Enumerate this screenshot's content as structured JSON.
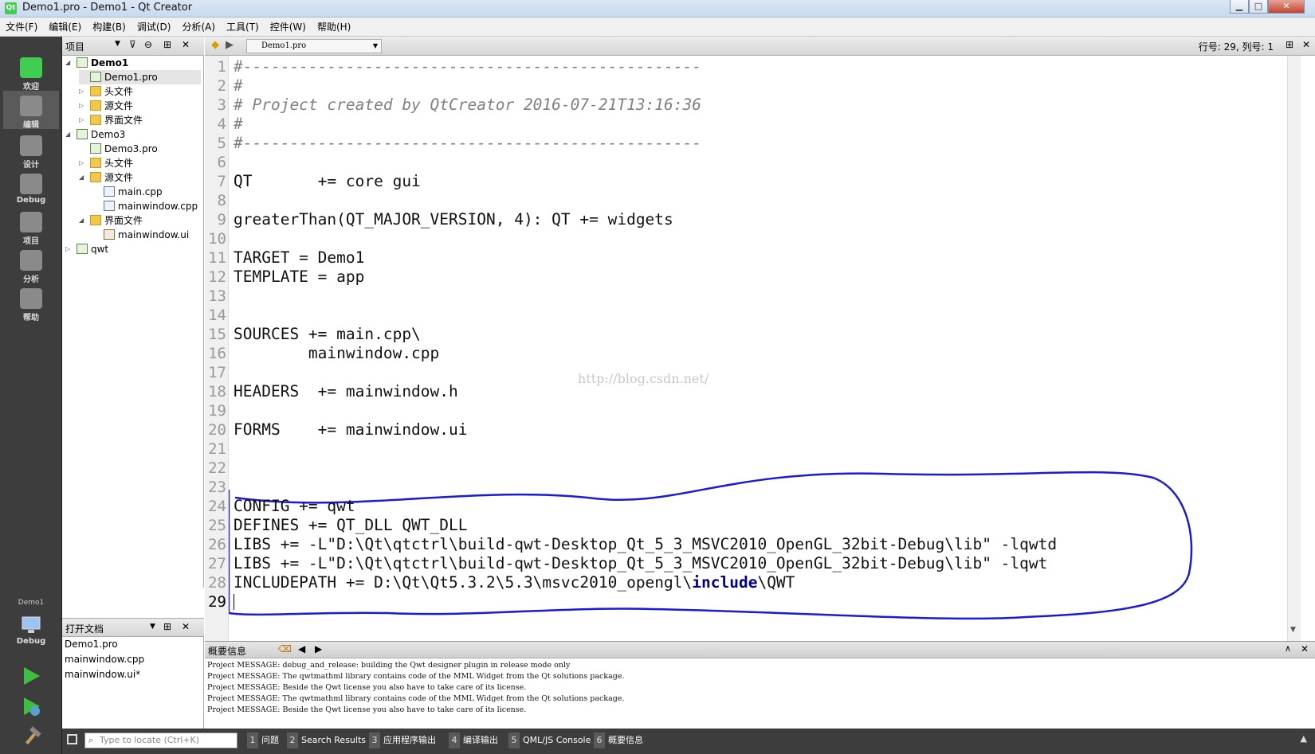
{
  "window": {
    "title": "Demo1.pro - Demo1 - Qt Creator",
    "app_icon": "Qt"
  },
  "menu": [
    "文件(F)",
    "编辑(E)",
    "构建(B)",
    "调试(D)",
    "分析(A)",
    "工具(T)",
    "控件(W)",
    "帮助(H)"
  ],
  "modes": [
    {
      "label": "欢迎",
      "icon": "qt-welcome-icon"
    },
    {
      "label": "编辑",
      "icon": "edit-icon",
      "selected": true
    },
    {
      "label": "设计",
      "icon": "design-icon"
    },
    {
      "label": "Debug",
      "icon": "debug-icon"
    },
    {
      "label": "项目",
      "icon": "projects-icon"
    },
    {
      "label": "分析",
      "icon": "analyze-icon"
    },
    {
      "label": "帮助",
      "icon": "help-icon"
    }
  ],
  "kit": {
    "project": "Demo1",
    "mode": "Debug"
  },
  "project_panel": {
    "title": "项目"
  },
  "tree": [
    {
      "label": "Demo1",
      "level": 0,
      "arrow": "◢",
      "icon": "pro",
      "bold": true
    },
    {
      "label": "Demo1.pro",
      "level": 1,
      "arrow": "",
      "icon": "pro",
      "selected": true
    },
    {
      "label": "头文件",
      "level": 1,
      "arrow": "▷",
      "icon": "folder"
    },
    {
      "label": "源文件",
      "level": 1,
      "arrow": "▷",
      "icon": "folder"
    },
    {
      "label": "界面文件",
      "level": 1,
      "arrow": "▷",
      "icon": "folder"
    },
    {
      "label": "Demo3",
      "level": 0,
      "arrow": "◢",
      "icon": "pro"
    },
    {
      "label": "Demo3.pro",
      "level": 1,
      "arrow": "",
      "icon": "pro"
    },
    {
      "label": "头文件",
      "level": 1,
      "arrow": "▷",
      "icon": "folder"
    },
    {
      "label": "源文件",
      "level": 1,
      "arrow": "◢",
      "icon": "folder"
    },
    {
      "label": "main.cpp",
      "level": 2,
      "arrow": "",
      "icon": "cpp"
    },
    {
      "label": "mainwindow.cpp",
      "level": 2,
      "arrow": "",
      "icon": "cpp"
    },
    {
      "label": "界面文件",
      "level": 1,
      "arrow": "◢",
      "icon": "folder"
    },
    {
      "label": "mainwindow.ui",
      "level": 2,
      "arrow": "",
      "icon": "ui"
    },
    {
      "label": "qwt",
      "level": 0,
      "arrow": "▷",
      "icon": "pro"
    }
  ],
  "open_docs": {
    "title": "打开文档",
    "items": [
      "Demo1.pro",
      "mainwindow.cpp",
      "mainwindow.ui*"
    ]
  },
  "editor": {
    "file": "Demo1.pro",
    "position": "行号: 29, 列号: 1",
    "lines": [
      {
        "n": "1",
        "text": "#-------------------------------------------------",
        "type": "comment"
      },
      {
        "n": "2",
        "text": "#",
        "type": "comment"
      },
      {
        "n": "3",
        "text": "# Project created by QtCreator 2016-07-21T13:16:36",
        "type": "comment"
      },
      {
        "n": "4",
        "text": "#",
        "type": "comment"
      },
      {
        "n": "5",
        "text": "#-------------------------------------------------",
        "type": "comment"
      },
      {
        "n": "6",
        "text": ""
      },
      {
        "n": "7",
        "text": "QT       += core gui"
      },
      {
        "n": "8",
        "text": ""
      },
      {
        "n": "9",
        "text": "greaterThan(QT_MAJOR_VERSION, 4): QT += widgets"
      },
      {
        "n": "10",
        "text": ""
      },
      {
        "n": "11",
        "text": "TARGET = Demo1"
      },
      {
        "n": "12",
        "text": "TEMPLATE = app"
      },
      {
        "n": "13",
        "text": ""
      },
      {
        "n": "14",
        "text": ""
      },
      {
        "n": "15",
        "text": "SOURCES += main.cpp\\"
      },
      {
        "n": "16",
        "text": "        mainwindow.cpp"
      },
      {
        "n": "17",
        "text": ""
      },
      {
        "n": "18",
        "text": "HEADERS  += mainwindow.h"
      },
      {
        "n": "19",
        "text": ""
      },
      {
        "n": "20",
        "text": "FORMS    += mainwindow.ui"
      },
      {
        "n": "21",
        "text": ""
      },
      {
        "n": "22",
        "text": ""
      },
      {
        "n": "23",
        "text": ""
      },
      {
        "n": "24",
        "text": "CONFIG += qwt"
      },
      {
        "n": "25",
        "text": "DEFINES += QT_DLL QWT_DLL"
      },
      {
        "n": "26",
        "text": "LIBS += -L\"D:\\Qt\\qtctrl\\build-qwt-Desktop_Qt_5_3_MSVC2010_OpenGL_32bit-Debug\\lib\" -lqwtd"
      },
      {
        "n": "27",
        "text": "LIBS += -L\"D:\\Qt\\qtctrl\\build-qwt-Desktop_Qt_5_3_MSVC2010_OpenGL_32bit-Debug\\lib\" -lqwt"
      },
      {
        "n": "28",
        "text": "INCLUDEPATH += D:\\Qt\\Qt5.3.2\\5.3\\msvc2010_opengl\\",
        "type": "include",
        "kw": "include",
        "tail": "\\QWT"
      },
      {
        "n": "29",
        "text": "",
        "current": true
      }
    ],
    "watermark": "http://blog.csdn.net/"
  },
  "output": {
    "title": "概要信息",
    "lines": [
      "Project MESSAGE: debug_and_release: building the Qwt designer plugin in release mode only",
      "Project MESSAGE: The qwtmathml library contains code of the MML Widget from the Qt solutions package.",
      "Project MESSAGE: Beside the Qwt license you also have to take care of its license.",
      "Project MESSAGE: The qwtmathml library contains code of the MML Widget from the Qt solutions package.",
      "Project MESSAGE: Beside the Qwt license you also have to take care of its license."
    ]
  },
  "statusbar": {
    "locate_placeholder": "Type to locate (Ctrl+K)",
    "tabs": [
      {
        "n": "1",
        "label": "问题"
      },
      {
        "n": "2",
        "label": "Search Results"
      },
      {
        "n": "3",
        "label": "应用程序输出"
      },
      {
        "n": "4",
        "label": "编译输出"
      },
      {
        "n": "5",
        "label": "QML/JS Console"
      },
      {
        "n": "6",
        "label": "概要信息"
      }
    ]
  },
  "colors": {
    "accent": "#41cd52",
    "annotation": "#1a1adb",
    "keyword": "#00008b"
  }
}
